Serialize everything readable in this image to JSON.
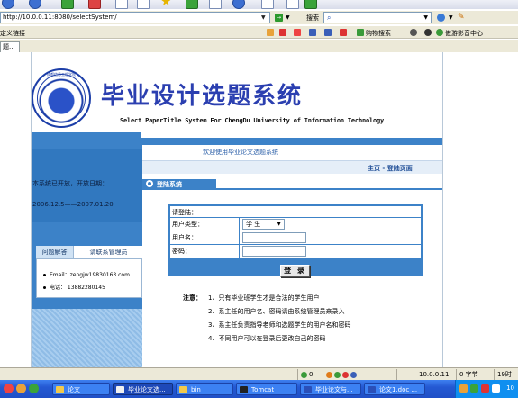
{
  "browser": {
    "address": "http://10.0.0.11:8080/selectSystem/",
    "search_label": "搜索",
    "links_label": "定义链接",
    "links_items": [
      "购物搜索",
      "傲游影音中心"
    ],
    "tab_label": "题..."
  },
  "header": {
    "site_title": "毕业设计选题系统",
    "site_subtitle": "Select PaperTitle System For ChengDu University of Information Technology",
    "logo_text": "成都信息工程学院"
  },
  "sidebar": {
    "status_text": "本系统已开放，开放日期：",
    "date_range": "2006.12.5——2007.01.20",
    "tabs": [
      "问题解答",
      "请联系管理员"
    ],
    "contact": {
      "email": "Email：zengjw19830163.com",
      "phone": "电话： 13882280145"
    }
  },
  "main": {
    "welcome": "欢迎使用毕业论文选题系统",
    "breadcrumb": "主页 - 登陆页面",
    "section_title": "登陆系统",
    "login": {
      "prompt": "请登陆：",
      "user_type_label": "用户类型：",
      "user_type_value": "学 生",
      "username_label": "用户名：",
      "password_label": "密码：",
      "submit_label": "登 录"
    },
    "notes_title": "注意：",
    "notes": [
      "1、只有毕业班学生才是合法的学生用户",
      "2、系主任的用户名、密码请由系统管理员来录入",
      "3、系主任负责指导老师和选题学生的用户名和密码",
      "4、不同用户可以在登录后更改自己的密码"
    ]
  },
  "statusbar": {
    "count": "0",
    "ip": "10.0.0.11",
    "bytes": "0 字节",
    "time": "19时"
  },
  "taskbar": {
    "items": [
      "论文",
      "毕业论文选...",
      "bin",
      "Tomcat",
      "毕业论文与...",
      "论文1.doc ..."
    ],
    "clock": "10"
  },
  "colors": {
    "primary_blue": "#3c82c8",
    "title_blue": "#2b3fb0",
    "taskbar_blue": "#2459d3"
  }
}
